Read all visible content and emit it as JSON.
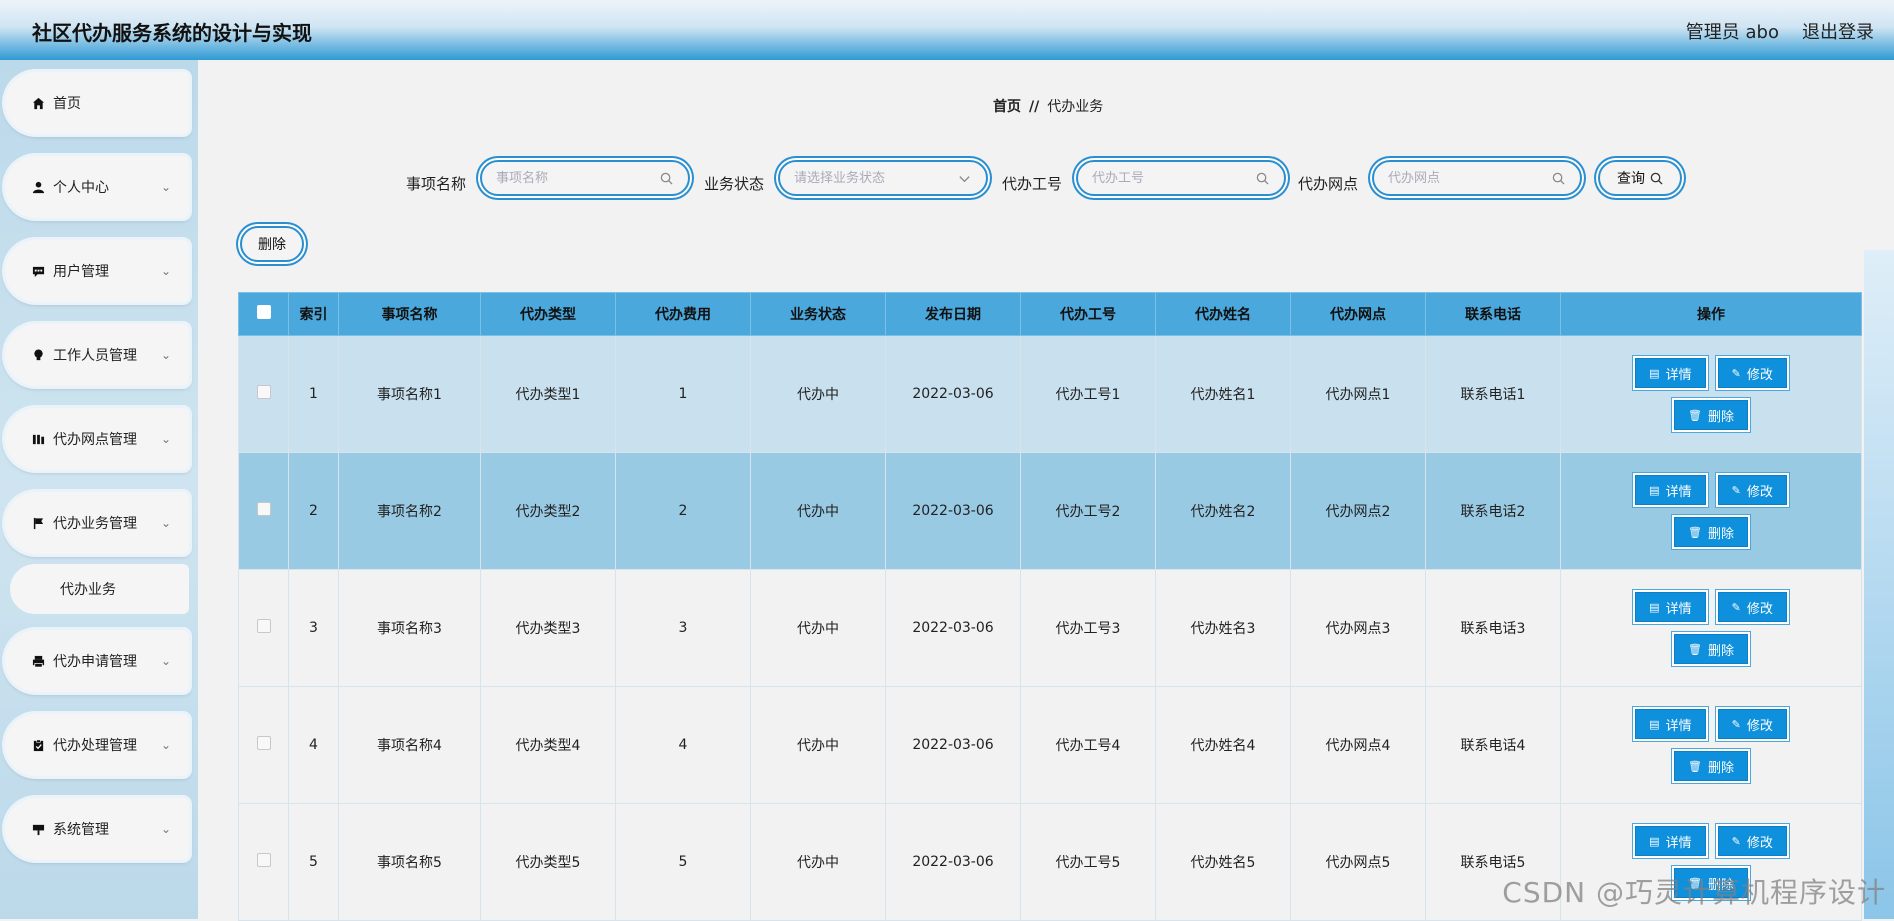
{
  "header": {
    "title": "社区代办服务系统的设计与实现",
    "user": "管理员 abo",
    "logout": "退出登录"
  },
  "sidebar": {
    "items": [
      {
        "label": "首页",
        "icon": "home-icon",
        "expandable": false
      },
      {
        "label": "个人中心",
        "icon": "user-icon",
        "expandable": true
      },
      {
        "label": "用户管理",
        "icon": "chat-icon",
        "expandable": true
      },
      {
        "label": "工作人员管理",
        "icon": "bulb-icon",
        "expandable": true
      },
      {
        "label": "代办网点管理",
        "icon": "bars-icon",
        "expandable": true
      },
      {
        "label": "代办业务管理",
        "icon": "flag-icon",
        "expandable": true
      },
      {
        "label": "代办申请管理",
        "icon": "print-icon",
        "expandable": true
      },
      {
        "label": "代办处理管理",
        "icon": "clipboard-icon",
        "expandable": true
      },
      {
        "label": "系统管理",
        "icon": "sign-icon",
        "expandable": true
      }
    ],
    "submenu": {
      "label": "代办业务"
    }
  },
  "breadcrumb": {
    "home": "首页",
    "separator": "//",
    "current": "代办业务"
  },
  "search": {
    "name_label": "事项名称",
    "name_placeholder": "事项名称",
    "status_label": "业务状态",
    "status_placeholder": "请选择业务状态",
    "staff_label": "代办工号",
    "staff_placeholder": "代办工号",
    "site_label": "代办网点",
    "site_placeholder": "代办网点",
    "query_button": "查询"
  },
  "toolbar": {
    "delete_button": "删除"
  },
  "table": {
    "headers": [
      "索引",
      "事项名称",
      "代办类型",
      "代办费用",
      "业务状态",
      "发布日期",
      "代办工号",
      "代办姓名",
      "代办网点",
      "联系电话",
      "操作"
    ],
    "actions": {
      "detail": "详情",
      "edit": "修改",
      "delete": "删除"
    },
    "rows": [
      {
        "index": "1",
        "name": "事项名称1",
        "type": "代办类型1",
        "fee": "1",
        "status": "代办中",
        "date": "2022-03-06",
        "staff_no": "代办工号1",
        "staff_name": "代办姓名1",
        "site": "代办网点1",
        "phone": "联系电话1"
      },
      {
        "index": "2",
        "name": "事项名称2",
        "type": "代办类型2",
        "fee": "2",
        "status": "代办中",
        "date": "2022-03-06",
        "staff_no": "代办工号2",
        "staff_name": "代办姓名2",
        "site": "代办网点2",
        "phone": "联系电话2"
      },
      {
        "index": "3",
        "name": "事项名称3",
        "type": "代办类型3",
        "fee": "3",
        "status": "代办中",
        "date": "2022-03-06",
        "staff_no": "代办工号3",
        "staff_name": "代办姓名3",
        "site": "代办网点3",
        "phone": "联系电话3"
      },
      {
        "index": "4",
        "name": "事项名称4",
        "type": "代办类型4",
        "fee": "4",
        "status": "代办中",
        "date": "2022-03-06",
        "staff_no": "代办工号4",
        "staff_name": "代办姓名4",
        "site": "代办网点4",
        "phone": "联系电话4"
      },
      {
        "index": "5",
        "name": "事项名称5",
        "type": "代办类型5",
        "fee": "5",
        "status": "代办中",
        "date": "2022-03-06",
        "staff_no": "代办工号5",
        "staff_name": "代办姓名5",
        "site": "代办网点5",
        "phone": "联系电话5"
      }
    ]
  },
  "watermark": "CSDN @巧灵计算机程序设计",
  "colors": {
    "accent": "#0f90dc",
    "header_row": "#4aa8dc",
    "row_selected": "#99cae3",
    "row_hover": "#c9e1ee"
  }
}
